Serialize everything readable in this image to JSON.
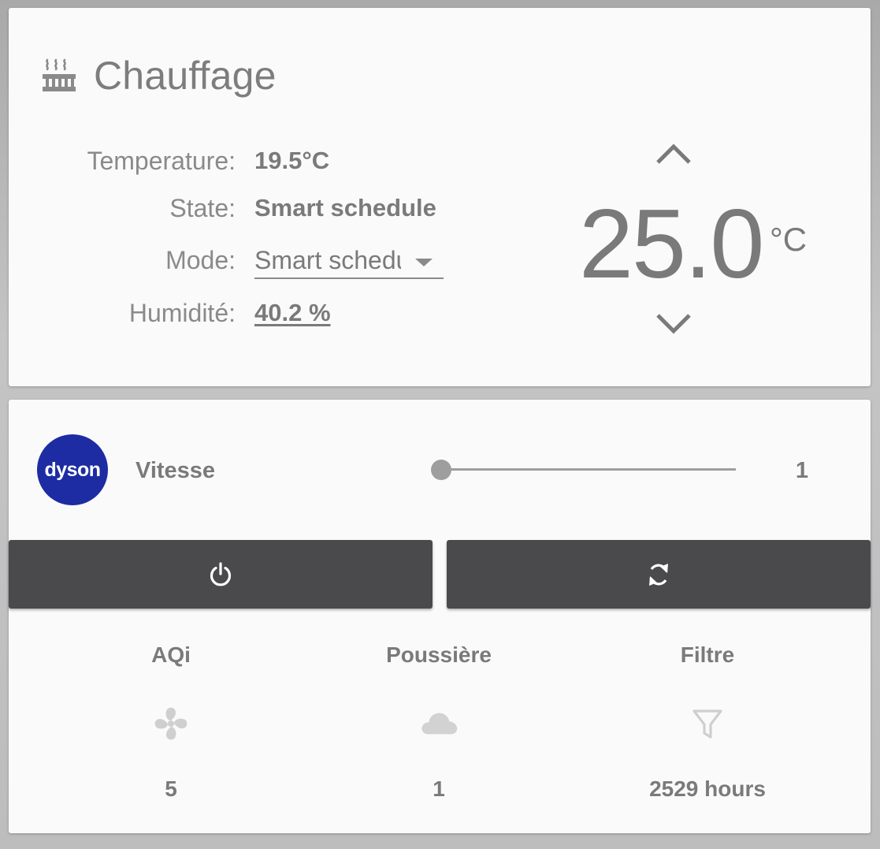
{
  "thermostat": {
    "title": "Chauffage",
    "icon": "radiator-icon",
    "attributes": {
      "temperature": {
        "label": "Temperature:",
        "value": "19.5°C"
      },
      "state": {
        "label": "State:",
        "value": "Smart schedule"
      },
      "mode": {
        "label": "Mode:",
        "value": "Smart schedule"
      },
      "humidity": {
        "label": "Humidité:",
        "value": "40.2 %"
      }
    },
    "target": {
      "value": "25.0",
      "unit": "°C"
    }
  },
  "dyson": {
    "logo_text": "dyson",
    "logo_color": "#1d2ca3",
    "speed": {
      "label": "Vitesse",
      "value": "1"
    },
    "buttons": {
      "power_icon": "power-icon",
      "sync_icon": "sync-icon",
      "color": "#4a4a4c"
    },
    "stats": [
      {
        "label": "AQi",
        "icon": "fan-icon",
        "value": "5"
      },
      {
        "label": "Poussière",
        "icon": "cloud-icon",
        "value": "1"
      },
      {
        "label": "Filtre",
        "icon": "filter-icon",
        "value": "2529 hours"
      }
    ]
  }
}
